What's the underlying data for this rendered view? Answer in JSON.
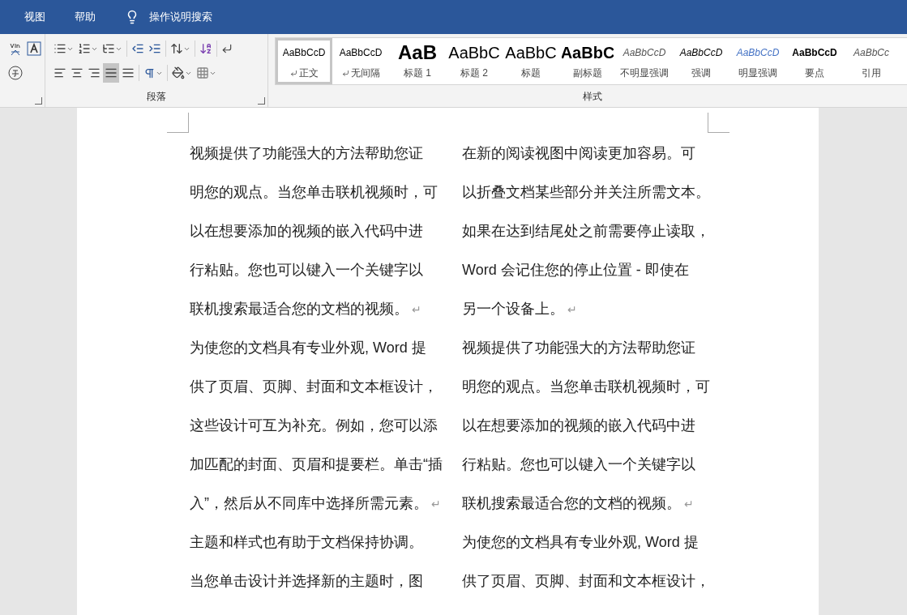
{
  "menu": [
    {
      "label": "视图"
    },
    {
      "label": "帮助"
    },
    {
      "label": "操作说明搜索",
      "kind": "search"
    }
  ],
  "ribbon": {
    "paragraph_group": {
      "label": "段落",
      "alignments": [
        {
          "kind": "left",
          "selected": false
        },
        {
          "kind": "center",
          "selected": false
        },
        {
          "kind": "right",
          "selected": false
        },
        {
          "kind": "justify",
          "selected": true
        },
        {
          "kind": "distributed",
          "selected": false
        }
      ]
    },
    "styles_group": {
      "label": "样式",
      "styles": [
        {
          "preview": "AaBbCcD",
          "name": "正文",
          "kind": "normal",
          "para_mark": true,
          "selected": true
        },
        {
          "preview": "AaBbCcD",
          "name": "无间隔",
          "kind": "normal",
          "para_mark": true,
          "selected": false
        },
        {
          "preview": "AaB",
          "name": "标题 1",
          "kind": "heading1",
          "para_mark": false,
          "selected": false
        },
        {
          "preview": "AaBbC",
          "name": "标题 2",
          "kind": "heading2",
          "para_mark": false,
          "selected": false
        },
        {
          "preview": "AaBbC",
          "name": "标题",
          "kind": "title",
          "para_mark": false,
          "selected": false
        },
        {
          "preview": "AaBbC",
          "name": "副标题",
          "kind": "subtitle",
          "para_mark": false,
          "selected": false
        },
        {
          "preview": "AaBbCcD",
          "name": "不明显强调",
          "kind": "subtle",
          "para_mark": false,
          "selected": false
        },
        {
          "preview": "AaBbCcD",
          "name": "强调",
          "kind": "emphasis",
          "para_mark": false,
          "selected": false
        },
        {
          "preview": "AaBbCcD",
          "name": "明显强调",
          "kind": "intense",
          "para_mark": false,
          "selected": false
        },
        {
          "preview": "AaBbCcD",
          "name": "要点",
          "kind": "strong",
          "para_mark": false,
          "selected": false
        },
        {
          "preview": "AaBbCc",
          "name": "引用",
          "kind": "quote",
          "para_mark": false,
          "selected": false
        }
      ]
    }
  },
  "document": {
    "columns": [
      {
        "lines": [
          {
            "text": "视频提供了功能强大的方法帮助您证"
          },
          {
            "text": "明您的观点。当您单击联机视频时，可"
          },
          {
            "text": "以在想要添加的视频的嵌入代码中进"
          },
          {
            "text": "行粘贴。您也可以键入一个关键字以"
          },
          {
            "text": "联机搜索最适合您的文档的视频。",
            "mark": "↵"
          },
          {
            "text": "为使您的文档具有专业外观, Word 提"
          },
          {
            "text": "供了页眉、页脚、封面和文本框设计，"
          },
          {
            "text": "这些设计可互为补充。例如，您可以添"
          },
          {
            "text": "加匹配的封面、页眉和提要栏。单击“插"
          },
          {
            "text": "入”，然后从不同库中选择所需元素。",
            "mark": "↵"
          },
          {
            "text": "主题和样式也有助于文档保持协调。"
          },
          {
            "text": "当您单击设计并选择新的主题时，图"
          }
        ]
      },
      {
        "lines": [
          {
            "text": "在新的阅读视图中阅读更加容易。可"
          },
          {
            "text": "以折叠文档某些部分并关注所需文本。"
          },
          {
            "text": "如果在达到结尾处之前需要停止读取，"
          },
          {
            "text": "Word 会记住您的停止位置 - 即使在"
          },
          {
            "text": "另一个设备上。",
            "mark": "↵"
          },
          {
            "text": "视频提供了功能强大的方法帮助您证"
          },
          {
            "text": "明您的观点。当您单击联机视频时，可"
          },
          {
            "text": "以在想要添加的视频的嵌入代码中进"
          },
          {
            "text": "行粘贴。您也可以键入一个关键字以"
          },
          {
            "text": "联机搜索最适合您的文档的视频。",
            "mark": "↵"
          },
          {
            "text": "为使您的文档具有专业外观, Word 提"
          },
          {
            "text": "供了页眉、页脚、封面和文本框设计，"
          }
        ]
      }
    ]
  }
}
